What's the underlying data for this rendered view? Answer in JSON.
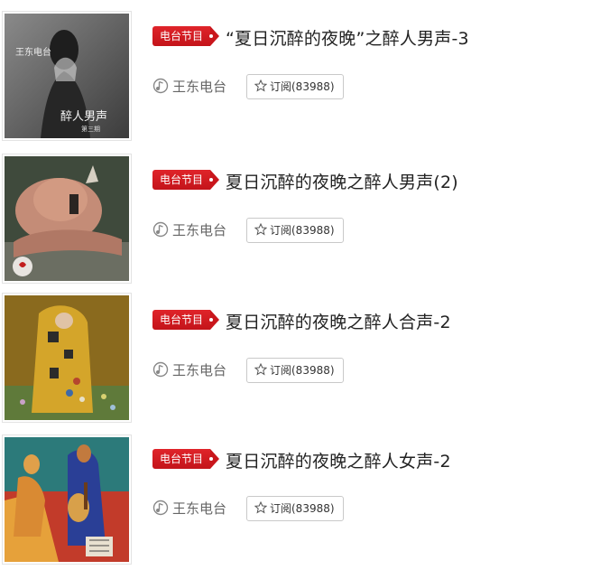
{
  "items": [
    {
      "tag": "电台节目",
      "title": "“夏日沉醉的夜晚”之醉人男声-3",
      "author": "王东电台",
      "subscribe": "订阅(83988)",
      "cover_text_1": "王东电台",
      "cover_text_2": "醉人男声",
      "cover_text_3": "第三期"
    },
    {
      "tag": "电台节目",
      "title": "夏日沉醉的夜晚之醉人男声(2)",
      "author": "王东电台",
      "subscribe": "订阅(83988)"
    },
    {
      "tag": "电台节目",
      "title": "夏日沉醉的夜晚之醉人合声-2",
      "author": "王东电台",
      "subscribe": "订阅(83988)"
    },
    {
      "tag": "电台节目",
      "title": "夏日沉醉的夜晚之醉人女声-2",
      "author": "王东电台",
      "subscribe": "订阅(83988)"
    }
  ],
  "icons": {
    "music": "music-note-icon",
    "star": "star-outline-icon"
  },
  "colors": {
    "tag_red": "#d11d23",
    "border": "#c9c9c9",
    "text": "#222222",
    "muted": "#666666"
  }
}
